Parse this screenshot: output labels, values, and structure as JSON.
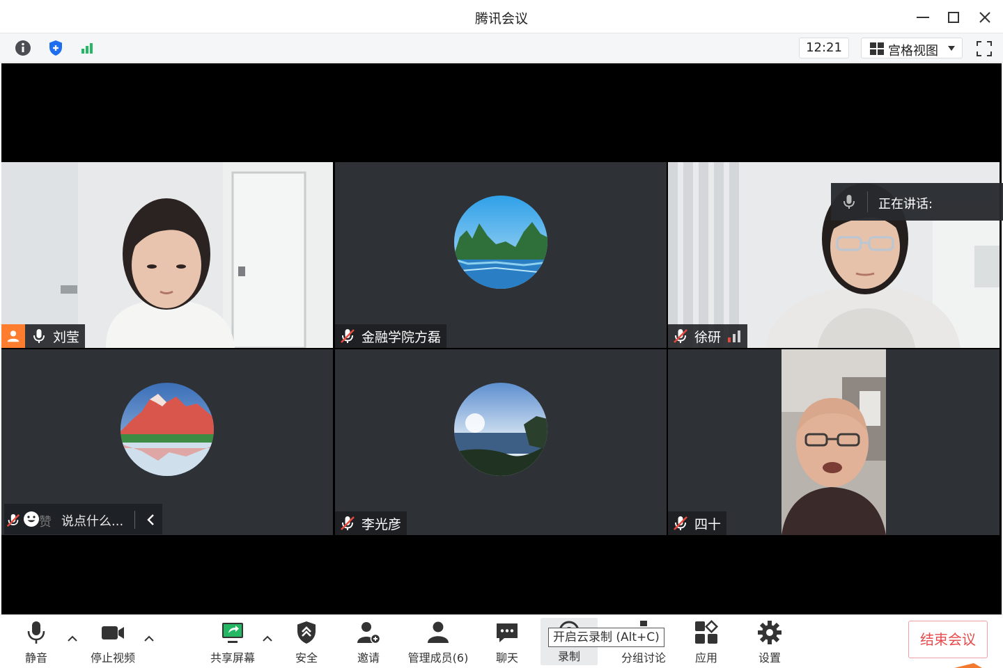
{
  "window": {
    "title": "腾讯会议"
  },
  "infobar": {
    "time": "12:21",
    "view_mode": "宫格视图"
  },
  "participants": [
    {
      "name": "刘莹",
      "mic": "on",
      "host": true,
      "video": true
    },
    {
      "name": "金融学院方磊",
      "mic": "muted",
      "host": false,
      "video": false,
      "avatar": "karst-river"
    },
    {
      "name": "徐研",
      "mic": "muted",
      "host": false,
      "video": true,
      "signal": "bars"
    },
    {
      "name": "",
      "mic": "muted",
      "host": false,
      "video": false,
      "avatar": "snow-mountain"
    },
    {
      "name": "李光彦",
      "mic": "muted",
      "host": false,
      "video": false,
      "avatar": "sea-view"
    },
    {
      "name": "四十",
      "mic": "muted",
      "host": false,
      "video": true
    }
  ],
  "speaking": {
    "label": "正在讲话:"
  },
  "chat": {
    "placeholder": "说点什么...",
    "covered_name": "赞"
  },
  "toolbar": {
    "mute": "静音",
    "stop_video": "停止视频",
    "share_screen": "共享屏幕",
    "security": "安全",
    "invite": "邀请",
    "manage_members": "管理成员(6)",
    "chat": "聊天",
    "record": "录制",
    "record_tooltip": "开启云录制 (Alt+C)",
    "breakout": "分组讨论",
    "apps": "应用",
    "settings": "设置",
    "end_meeting": "结束会议"
  },
  "colors": {
    "host_badge": "#ff7d2e",
    "muted_red": "#e84a3f",
    "end_red": "#e64b4b",
    "tile_bg": "#2e3135",
    "share_green": "#25b864"
  }
}
